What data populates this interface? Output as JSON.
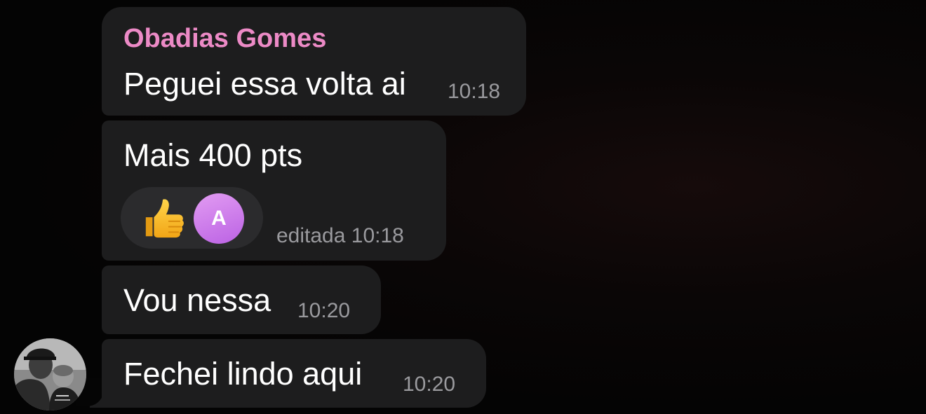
{
  "chat": {
    "sender_name": "Obadias Gomes",
    "colors": {
      "background": "#050505",
      "bubble": "#1d1d1e",
      "sender_name": "#ec8ac6",
      "timestamp": "#9a9a9e",
      "reaction_pill": "#2b2b2d",
      "reaction_avatar": "#c877e8"
    },
    "messages": [
      {
        "text": "Peguei essa volta ai",
        "time": "10:18"
      },
      {
        "text": "Mais 400 pts",
        "time": "editada 10:18",
        "reaction": {
          "emoji": "thumbs-up-icon",
          "reactor_initial": "A"
        }
      },
      {
        "text": "Vou nessa",
        "time": "10:20"
      },
      {
        "text": "Fechei lindo aqui",
        "time": "10:20"
      }
    ],
    "avatar_icon": "user-avatar-photo"
  }
}
